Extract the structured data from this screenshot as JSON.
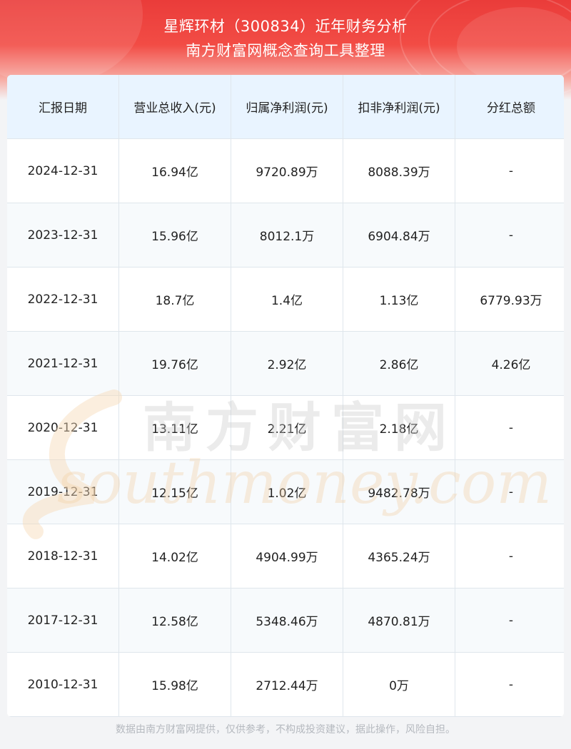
{
  "header": {
    "title_line1": "星辉环材（300834）近年财务分析",
    "title_line2": "南方财富网概念查询工具整理"
  },
  "table": {
    "columns": [
      "汇报日期",
      "营业总收入(元)",
      "归属净利润(元)",
      "扣非净利润(元)",
      "分红总额"
    ],
    "rows": [
      [
        "2024-12-31",
        "16.94亿",
        "9720.89万",
        "8088.39万",
        "-"
      ],
      [
        "2023-12-31",
        "15.96亿",
        "8012.1万",
        "6904.84万",
        "-"
      ],
      [
        "2022-12-31",
        "18.7亿",
        "1.4亿",
        "1.13亿",
        "6779.93万"
      ],
      [
        "2021-12-31",
        "19.76亿",
        "2.92亿",
        "2.86亿",
        "4.26亿"
      ],
      [
        "2020-12-31",
        "13.11亿",
        "2.21亿",
        "2.18亿",
        "-"
      ],
      [
        "2019-12-31",
        "12.15亿",
        "1.02亿",
        "9482.78万",
        "-"
      ],
      [
        "2018-12-31",
        "14.02亿",
        "4904.99万",
        "4365.24万",
        "-"
      ],
      [
        "2017-12-31",
        "12.58亿",
        "5348.46万",
        "4870.81万",
        "-"
      ],
      [
        "2010-12-31",
        "15.98亿",
        "2712.44万",
        "0万",
        "-"
      ]
    ]
  },
  "watermark": {
    "cn_text": "南方财富网",
    "en_text": "southmoney.com"
  },
  "footer": {
    "disclaimer": "数据由南方财富网提供，仅供参考，不构成投资建议，据此操作，风险自担。"
  },
  "colors": {
    "header_red": "#ea3c3a",
    "table_header_bg": "#e9f4ff",
    "grid_line": "#dfe6ec"
  }
}
